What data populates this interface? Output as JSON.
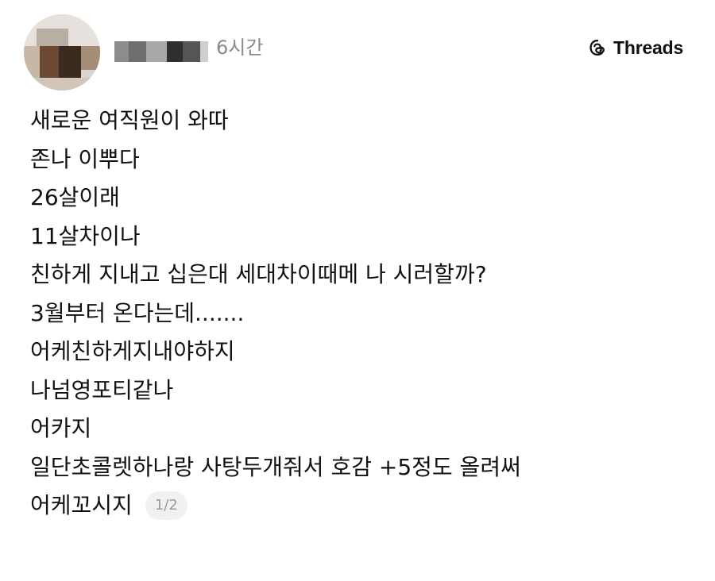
{
  "post": {
    "username_hidden": true,
    "time": "6시간",
    "brand": {
      "name": "Threads",
      "icon": "threads-logo-icon"
    },
    "lines": [
      "새로운 여직원이 와따",
      "존나 이뿌다",
      "26살이래",
      "11살차이나",
      "친하게 지내고 십은대 세대차이때메 나 시러할까?",
      "3월부터 온다는데.......",
      "어케친하게지내야하지",
      "나넘영포티같나",
      "어카지",
      "일단초콜렛하나랑 사탕두개줘서 호감 +5정도 올려써",
      "어케꼬시지"
    ],
    "page_indicator": "1/2"
  },
  "colors": {
    "text": "#111111",
    "muted": "#8a8a8a",
    "pill_bg": "#f1f1f1",
    "pill_text": "#9a9a9a"
  }
}
